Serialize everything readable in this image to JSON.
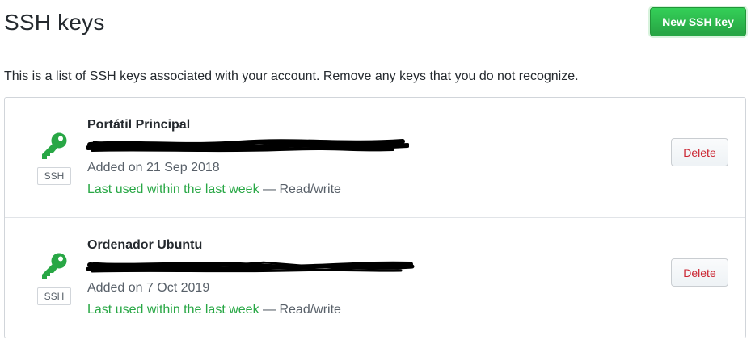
{
  "header": {
    "title": "SSH keys",
    "new_key_label": "New SSH key"
  },
  "intro": "This is a list of SSH keys associated with your account. Remove any keys that you do not recognize.",
  "keys": [
    {
      "title": "Portátil Principal",
      "badge": "SSH",
      "added": "Added on 21 Sep 2018",
      "last_used": "Last used within the last week",
      "access": "— Read/write",
      "delete_label": "Delete"
    },
    {
      "title": "Ordenador Ubuntu",
      "badge": "SSH",
      "added": "Added on 7 Oct 2019",
      "last_used": "Last used within the last week",
      "access": "— Read/write",
      "delete_label": "Delete"
    }
  ],
  "colors": {
    "accent_green": "#28a745",
    "danger_red": "#cb2431",
    "muted_text": "#586069"
  }
}
